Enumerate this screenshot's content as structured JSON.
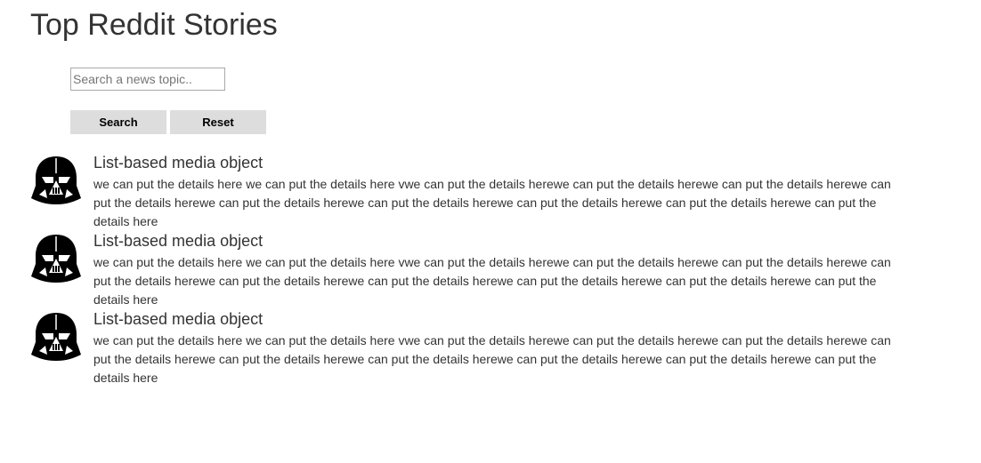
{
  "header": {
    "title": "Top Reddit Stories"
  },
  "search": {
    "placeholder": "Search a news topic..",
    "value": "",
    "search_label": "Search",
    "reset_label": "Reset"
  },
  "stories": [
    {
      "avatar_icon": "darth-vader-icon",
      "heading": "List-based media object",
      "text": "we can put the details here we can put the details here vwe can put the details herewe can put the details herewe can put the details herewe can put the details herewe can put the details herewe can put the details herewe can put the details herewe can put the details herewe can put the details here"
    },
    {
      "avatar_icon": "darth-vader-icon",
      "heading": "List-based media object",
      "text": "we can put the details here we can put the details here vwe can put the details herewe can put the details herewe can put the details herewe can put the details herewe can put the details herewe can put the details herewe can put the details herewe can put the details herewe can put the details here"
    },
    {
      "avatar_icon": "darth-vader-icon",
      "heading": "List-based media object",
      "text": "we can put the details here we can put the details here vwe can put the details herewe can put the details herewe can put the details herewe can put the details herewe can put the details herewe can put the details herewe can put the details herewe can put the details herewe can put the details here"
    }
  ]
}
